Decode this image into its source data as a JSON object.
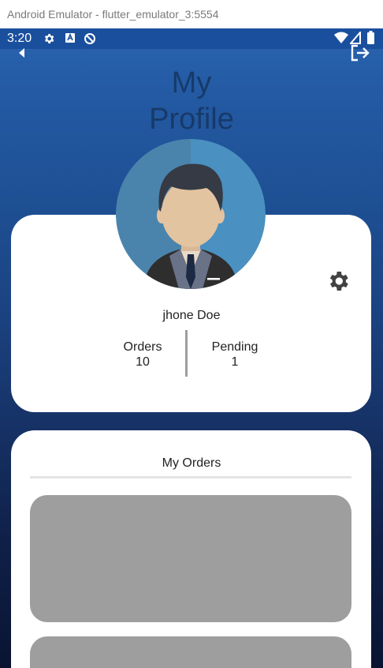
{
  "window": {
    "title": "Android Emulator - flutter_emulator_3:5554"
  },
  "status_bar": {
    "time": "3:20",
    "left_icons": [
      "settings-icon",
      "keyboard-icon",
      "data-saver-icon"
    ],
    "right_icons": [
      "wifi-icon",
      "signal-icon",
      "battery-icon"
    ]
  },
  "app_bar": {
    "back_icon": "back-arrow-icon",
    "logout_icon": "logout-icon"
  },
  "header": {
    "title_line1": "My",
    "title_line2": "Profile"
  },
  "profile": {
    "name": "jhone Doe",
    "stats": {
      "orders_label": "Orders",
      "orders_value": "10",
      "pending_label": "Pending",
      "pending_value": "1"
    },
    "settings_icon": "gear-icon"
  },
  "orders": {
    "title": "My Orders",
    "items_count_visible": 2
  },
  "colors": {
    "gradient_top": "#2a64b0",
    "gradient_bottom": "#0a1432",
    "card": "#ffffff",
    "placeholder": "#9e9e9e",
    "title_text": "#173a6a",
    "avatar_bg": "#4a90c0"
  }
}
